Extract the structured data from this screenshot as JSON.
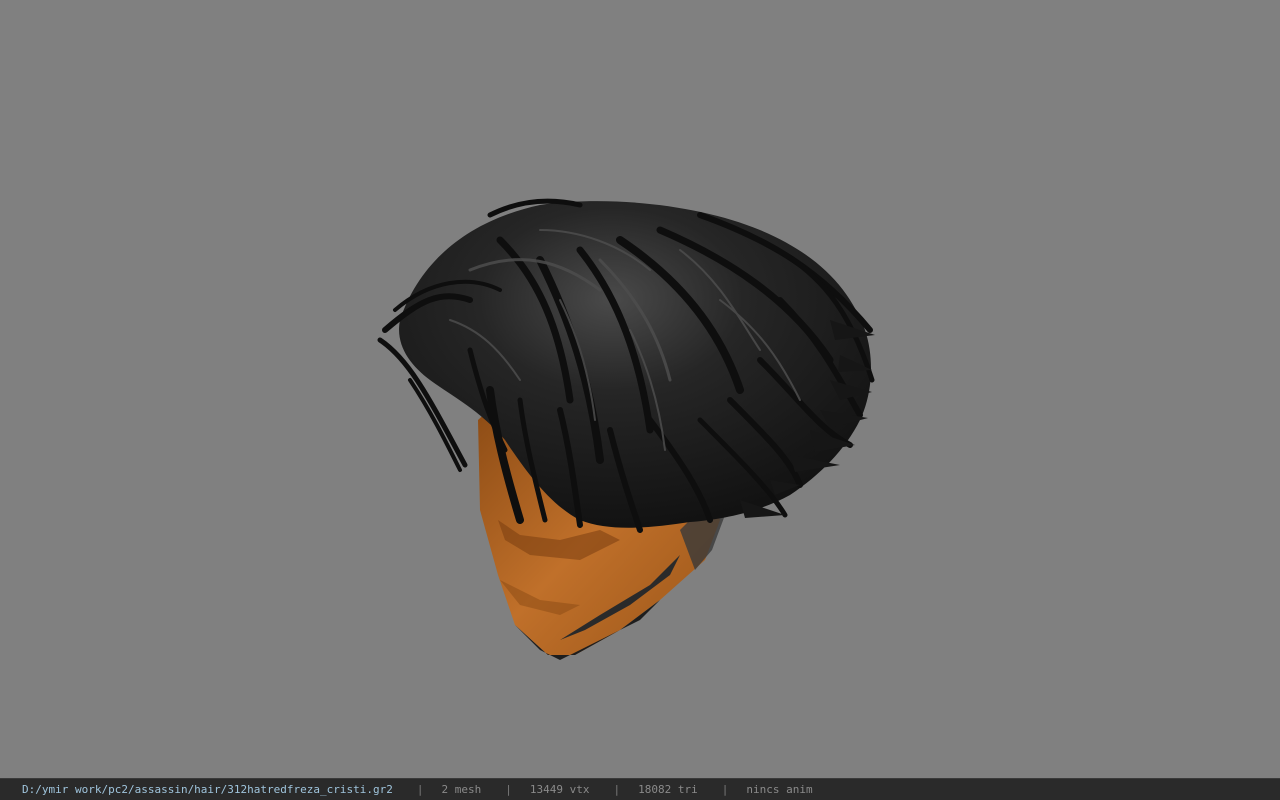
{
  "viewer": {
    "background_color": "#808080",
    "model_description": "3D hair mesh preview",
    "hair_color": "#1a1a1a",
    "skin_color": "#b5651d"
  },
  "statusbar": {
    "file_path": "D:/ymir work/pc2/assassin/hair/312hatredfreza_cristi.gr2",
    "separator": "|",
    "mesh_count": "2 mesh",
    "vertex_count": "13449 vtx",
    "triangle_count": "18082 tri",
    "anim_status": "nincs anim",
    "path_color": "#9fc4dc",
    "text_color": "#8a8a8a",
    "bar_color": "#2a2a2a"
  }
}
